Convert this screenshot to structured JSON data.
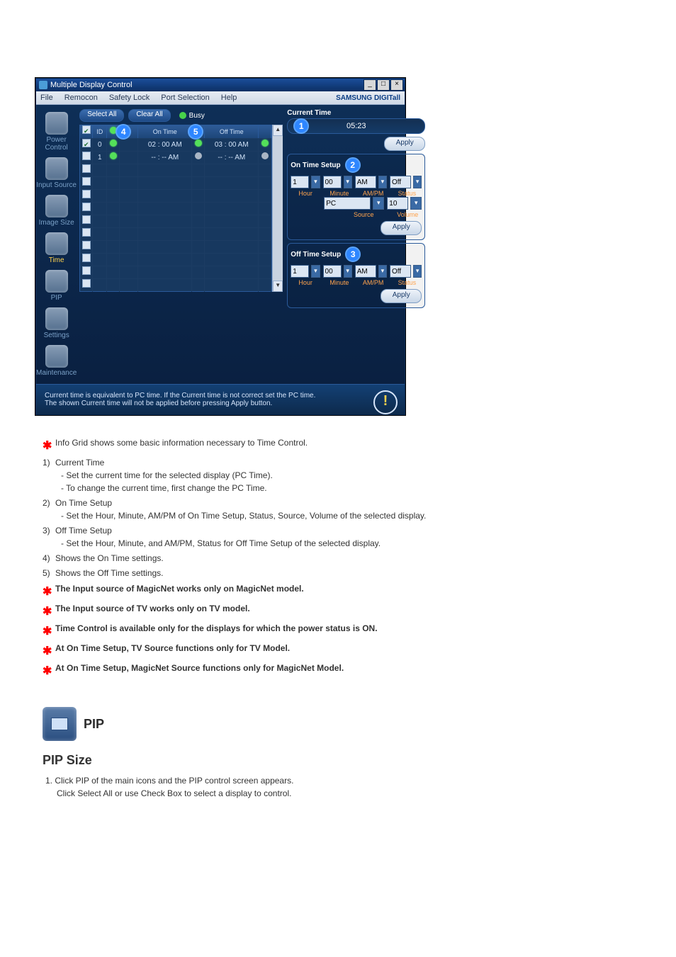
{
  "window": {
    "title": "Multiple Display Control",
    "menus": [
      "File",
      "Remocon",
      "Safety Lock",
      "Port Selection",
      "Help"
    ],
    "brand": "SAMSUNG DIGITall"
  },
  "sidebar": {
    "items": [
      {
        "label": "Power Control"
      },
      {
        "label": "Input Source"
      },
      {
        "label": "Image Size"
      },
      {
        "label": "Time"
      },
      {
        "label": "PIP"
      },
      {
        "label": "Settings"
      },
      {
        "label": "Maintenance"
      }
    ]
  },
  "toolbar": {
    "select_all": "Select All",
    "clear_all": "Clear All",
    "busy": "Busy"
  },
  "grid": {
    "head": {
      "checkbox": "",
      "id": "ID",
      "on_time": "On Time",
      "off_time": "Off Time"
    },
    "rows": [
      {
        "checked": true,
        "id": "0",
        "pwr1": "green",
        "on": "02 : 00  AM",
        "p2": "green",
        "off": "03 : 00  AM",
        "p3": "green"
      },
      {
        "checked": false,
        "id": "1",
        "pwr1": "green",
        "on": "-- : --  AM",
        "p2": "grey",
        "off": "-- : --  AM",
        "p3": "grey"
      }
    ]
  },
  "right": {
    "current_time_label": "Current Time",
    "clock": "05:23",
    "apply": "Apply",
    "on_time_setup": "On Time Setup",
    "off_time_setup": "Off Time Setup",
    "hour": "1",
    "minute": "00",
    "ampm": "AM",
    "status": "Off",
    "source": "PC",
    "volume": "10",
    "off_hour": "1",
    "off_minute": "00",
    "off_ampm": "AM",
    "off_status": "Off",
    "labels": {
      "hour": "Hour",
      "minute": "Minute",
      "ampm": "AM/PM",
      "status": "Status",
      "source": "Source",
      "volume": "Volume"
    }
  },
  "footer": {
    "line1": "Current time is equivalent to PC time. If the Current time is not correct set the PC time.",
    "line2": "The shown Current time will not be applied before pressing Apply button."
  },
  "doc": {
    "intro": "Info Grid shows some basic information necessary to Time Control.",
    "items": [
      {
        "num": "1)",
        "title": "Current Time",
        "lines": [
          "- Set the current time for the selected display (PC Time).",
          "- To change the current time, first change the PC Time."
        ]
      },
      {
        "num": "2)",
        "title": "On Time Setup",
        "lines": [
          "- Set the Hour, Minute, AM/PM of On Time Setup, Status, Source, Volume of the selected display."
        ]
      },
      {
        "num": "3)",
        "title": "Off Time Setup",
        "lines": [
          "- Set the Hour, Minute, and AM/PM, Status for Off Time Setup of the selected display."
        ]
      },
      {
        "num": "4)",
        "title": "Shows the On Time settings.",
        "lines": []
      },
      {
        "num": "5)",
        "title": "Shows the Off Time settings.",
        "lines": []
      }
    ],
    "stars": [
      "The Input source of MagicNet works only on MagicNet model.",
      "The Input source of TV works only on TV model.",
      "Time Control is available only for the displays for which the power status is ON.",
      "At On Time Setup, TV Source functions only for TV Model.",
      "At On Time Setup, MagicNet Source functions only for MagicNet Model."
    ],
    "section_title": "PIP",
    "sub_title": "PIP Size",
    "sub_body": [
      "Click PIP of the main icons and the PIP control screen appears.",
      "Click Select All or use Check Box to select a display to control."
    ]
  }
}
